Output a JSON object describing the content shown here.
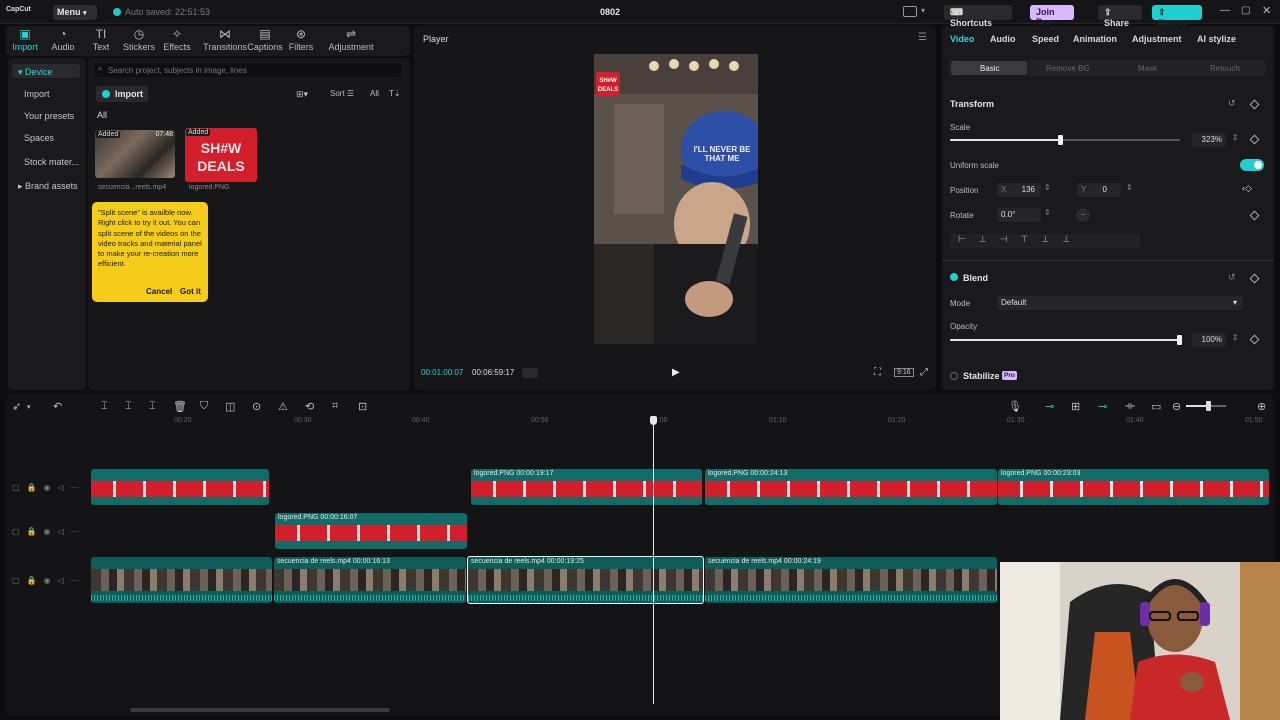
{
  "titlebar": {
    "logo": "CapCut",
    "menu_label": "Menu",
    "autosave": "Auto saved: 22:51:53",
    "project_title": "0802",
    "shortcuts_label": "Shortcuts",
    "join_pro_label": "Join Pro",
    "share_label": "Share",
    "export_label": "Export"
  },
  "toolbar": {
    "items": [
      {
        "label": "Import",
        "icon": "import-icon"
      },
      {
        "label": "Audio",
        "icon": "audio-icon"
      },
      {
        "label": "Text",
        "icon": "text-icon"
      },
      {
        "label": "Stickers",
        "icon": "stickers-icon"
      },
      {
        "label": "Effects",
        "icon": "effects-icon"
      },
      {
        "label": "Transitions",
        "icon": "transitions-icon"
      },
      {
        "label": "Captions",
        "icon": "captions-icon"
      },
      {
        "label": "Filters",
        "icon": "filters-icon"
      },
      {
        "label": "Adjustment",
        "icon": "adjustment-icon"
      }
    ]
  },
  "sidenav": {
    "items": [
      "Device",
      "Import",
      "Your presets",
      "Spaces",
      "Stock mater...",
      "Brand assets"
    ]
  },
  "media": {
    "search_placeholder": "Search project, subjects in image, lines",
    "import_label": "Import",
    "sort_label": "Sort",
    "all_label": "All",
    "filter_all": "All",
    "items": [
      {
        "badge": "Added",
        "duration": "07:48",
        "name": "secuencia...reels.mp4"
      },
      {
        "badge": "Added",
        "duration": "",
        "name": "logored.PNG"
      }
    ],
    "tip": {
      "text": "\"Split scene\" is availble now. Right click to try it out. You can split scene of the videos on the video tracks and material panel to make your re-creation more efficient.",
      "cancel": "Cancel",
      "got_it": "Got it"
    }
  },
  "player": {
    "title": "Player",
    "current_time": "00:01:00:07",
    "total_time": "00:06:59:17",
    "ratio_label": "9:16",
    "cap_text": "I'LL NEVER BE THAT ME"
  },
  "props": {
    "tabs": [
      "Video",
      "Audio",
      "Speed",
      "Animation",
      "Adjustment",
      "AI stylize"
    ],
    "subtabs": [
      "Basic",
      "Remove BG",
      "Mask",
      "Retouch"
    ],
    "transform_title": "Transform",
    "scale_label": "Scale",
    "scale_value": "323%",
    "scale_fraction": 0.48,
    "uniform_label": "Uniform scale",
    "position_label": "Position",
    "pos_x_label": "X",
    "pos_x": "136",
    "pos_y_label": "Y",
    "pos_y": "0",
    "rotate_label": "Rotate",
    "rotate_value": "0.0°",
    "blend_title": "Blend",
    "mode_label": "Mode",
    "mode_value": "Default",
    "opacity_label": "Opacity",
    "opacity_value": "100%",
    "opacity_fraction": 1.0,
    "stabilize_title": "Stabilize",
    "stabilize_badge": "Pro"
  },
  "timeline": {
    "ruler": [
      "00:20",
      "00:30",
      "00:40",
      "00:50",
      "01:00",
      "01:10",
      "01:20",
      "01:30",
      "01:40",
      "01:50"
    ],
    "clips": [
      {
        "track": "overlay1",
        "label": "logored.PNG  00:00:19:17"
      },
      {
        "track": "overlay1",
        "label": "logored.PNG  00:00:24:13"
      },
      {
        "track": "overlay1",
        "label": "logored.PNG  00:00:23:03"
      },
      {
        "track": "overlay2",
        "label": "logored.PNG  00:00:16:07"
      },
      {
        "track": "main",
        "label": "secuencia de reels.mp4  00:00:16:13"
      },
      {
        "track": "main",
        "label": "secuencia de reels.mp4  00:00:19:25"
      },
      {
        "track": "main",
        "label": "secuencia de reels.mp4  00:00:24:19"
      }
    ]
  },
  "colors": {
    "accent": "#1fd0d0",
    "pro": "#d8b8ff",
    "tip": "#f5cc1a",
    "brand_red": "#d21f2b"
  }
}
